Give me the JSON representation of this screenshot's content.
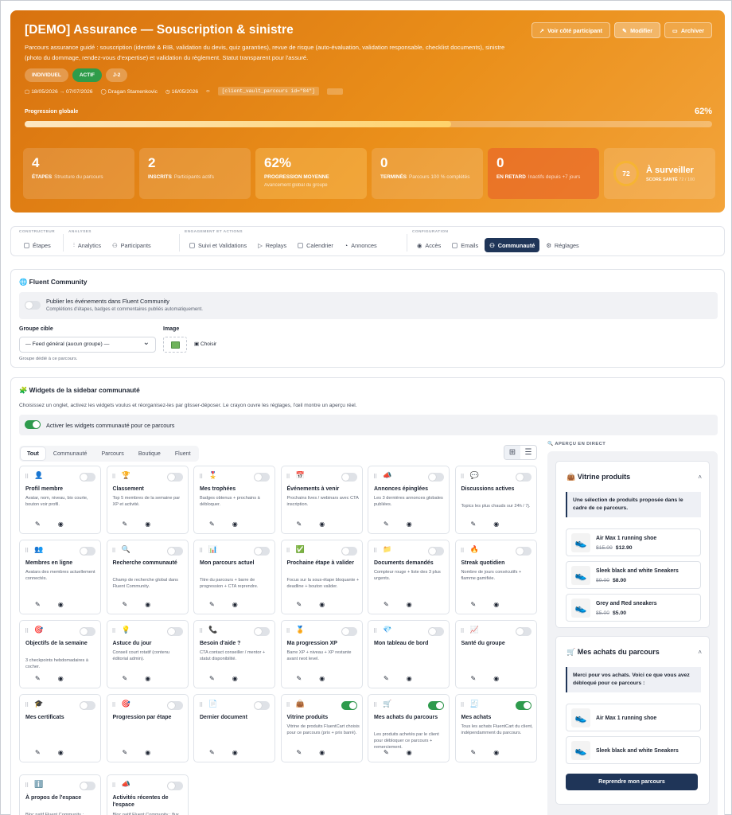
{
  "header": {
    "title": "[DEMO] Assurance — Souscription & sinistre",
    "description": "Parcours assurance guidé : souscription (identité & RIB, validation du devis, quiz garanties), revue de risque (auto-évaluation, validation responsable, checklist documents), sinistre (photo du dommage, rendez-vous d'expertise) et validation du règlement. Statut transparent pour l'assuré.",
    "buttons": {
      "view": "Voir côté participant",
      "edit": "Modifier",
      "archive": "Archiver"
    },
    "tags": [
      "INDIVIDUEL",
      "ACTIF",
      "J-2"
    ],
    "meta": {
      "dates": "18/05/2026 → 07/07/2026",
      "author": "Dragan Stamenkovic",
      "created": "16/05/2026",
      "shortcode": "[client_vault_parcours id=\"84\"]"
    },
    "progress": {
      "label": "Progression globale",
      "value_text": "62%",
      "value": 62
    },
    "stats": [
      {
        "value": "4",
        "label": "ÉTAPES",
        "hint": "Structure du parcours"
      },
      {
        "value": "2",
        "label": "INSCRITS",
        "hint": "Participants actifs"
      },
      {
        "value": "62%",
        "label": "PROGRESSION MOYENNE",
        "sub": "Avancement global du groupe"
      },
      {
        "value": "0",
        "label": "TERMINÉS",
        "hint": "Parcours 100 % complétés"
      },
      {
        "value": "0",
        "label": "EN RETARD",
        "hint": "Inactifs depuis +7 jours"
      }
    ],
    "score": {
      "value": "72",
      "title": "À surveiller",
      "label": "SCORE SANTÉ",
      "detail": "72 / 100"
    }
  },
  "nav": {
    "groups": [
      {
        "label": "CONSTRUCTEUR",
        "items": [
          "Étapes"
        ]
      },
      {
        "label": "ANALYSES",
        "items": [
          "Analytics",
          "Participants"
        ]
      },
      {
        "label": "ENGAGEMENT ET ACTIONS",
        "items": [
          "Suivi et Validations",
          "Replays",
          "Calendrier",
          "Annonces"
        ]
      },
      {
        "label": "CONFIGURATION",
        "items": [
          "Accès",
          "Emails",
          "Communauté",
          "Réglages"
        ]
      }
    ],
    "active": "Communauté"
  },
  "fluent": {
    "title": "Fluent Community",
    "publish_title": "Publier les événements dans Fluent Community",
    "publish_sub": "Complétions d'étapes, badges et commentaires publiés automatiquement.",
    "publish_on": false,
    "group_label": "Groupe cible",
    "group_value": "— Feed général (aucun groupe) —",
    "group_hint": "Groupe dédié à ce parcours.",
    "image_label": "Image",
    "choose": "Choisir"
  },
  "widgets": {
    "title": "Widgets de la sidebar communauté",
    "subtitle": "Choisissez un onglet, activez les widgets voulus et réorganisez-les par glisser-déposer. Le crayon ouvre les réglages, l'œil montre un aperçu réel.",
    "enable_label": "Activer les widgets communauté pour ce parcours",
    "enabled": true,
    "tabs": [
      "Tout",
      "Communauté",
      "Parcours",
      "Boutique",
      "Fluent"
    ],
    "active_tab": "Tout",
    "items": [
      {
        "icon": "👤",
        "name": "Profil membre",
        "desc": "Avatar, nom, niveau, bio courte, bouton voir profil.",
        "on": false
      },
      {
        "icon": "🏆",
        "name": "Classement",
        "desc": "Top 5 membres de la semaine par XP et activité.",
        "on": false
      },
      {
        "icon": "🎖️",
        "name": "Mes trophées",
        "desc": "Badges obtenus + prochains à débloquer.",
        "on": false
      },
      {
        "icon": "📅",
        "name": "Événements à venir",
        "desc": "Prochains lives / webinars avec CTA inscription.",
        "on": false
      },
      {
        "icon": "📣",
        "name": "Annonces épinglées",
        "desc": "Les 3 dernières annonces globales publiées.",
        "on": false
      },
      {
        "icon": "💬",
        "name": "Discussions actives",
        "desc": "Topics les plus chauds sur 24h / 7j.",
        "on": false
      },
      {
        "icon": "👥",
        "name": "Membres en ligne",
        "desc": "Avatars des membres actuellement connectés.",
        "on": false
      },
      {
        "icon": "🔍",
        "name": "Recherche communauté",
        "desc": "Champ de recherche global dans Fluent Community.",
        "on": false
      },
      {
        "icon": "📊",
        "name": "Mon parcours actuel",
        "desc": "Titre du parcours + barre de progression + CTA reprendre.",
        "on": false
      },
      {
        "icon": "✅",
        "name": "Prochaine étape à valider",
        "desc": "Focus sur la sous-étape bloquante + deadline + bouton valider.",
        "on": false
      },
      {
        "icon": "📁",
        "name": "Documents demandés",
        "desc": "Compteur rouge + liste des 3 plus urgents.",
        "on": false
      },
      {
        "icon": "🔥",
        "name": "Streak quotidien",
        "desc": "Nombre de jours consécutifs + flamme gamifiée.",
        "on": false
      },
      {
        "icon": "🎯",
        "name": "Objectifs de la semaine",
        "desc": "3 checkpoints hebdomadaires à cocher.",
        "on": false
      },
      {
        "icon": "💡",
        "name": "Astuce du jour",
        "desc": "Conseil court rotatif (contenu éditorial admin).",
        "on": false
      },
      {
        "icon": "📞",
        "name": "Besoin d'aide ?",
        "desc": "CTA contact conseiller / mentor + statut disponibilité.",
        "on": false
      },
      {
        "icon": "🏅",
        "name": "Ma progression XP",
        "desc": "Barre XP + niveau + XP restante avant next level.",
        "on": false
      },
      {
        "icon": "💎",
        "name": "Mon tableau de bord",
        "desc": "",
        "on": false
      },
      {
        "icon": "📈",
        "name": "Santé du groupe",
        "desc": "",
        "on": false
      },
      {
        "icon": "🎓",
        "name": "Mes certificats",
        "desc": "",
        "on": false
      },
      {
        "icon": "🎯",
        "name": "Progression par étape",
        "desc": "",
        "on": false
      },
      {
        "icon": "📄",
        "name": "Dernier document",
        "desc": "",
        "on": false
      },
      {
        "icon": "👜",
        "name": "Vitrine produits",
        "desc": "Vitrine de produits FluentCart choisis pour ce parcours (prix + prix barré).",
        "on": true
      },
      {
        "icon": "🛒",
        "name": "Mes achats du parcours",
        "desc": "Les produits achetés par le client pour débloquer ce parcours + remerciement.",
        "on": true
      },
      {
        "icon": "🧾",
        "name": "Mes achats",
        "desc": "Tous les achats FluentCart du client, indépendamment du parcours.",
        "on": true
      },
      {
        "icon": "ℹ️",
        "name": "À propos de l'espace",
        "desc": "Bloc natif Fluent Community : description et informations de",
        "on": false
      },
      {
        "icon": "📣",
        "name": "Activités récentes de l'espace",
        "desc": "Bloc natif Fluent Community : flux des dernières activités de",
        "on": false
      }
    ]
  },
  "preview": {
    "label": "APERÇU EN DIRECT",
    "showcase": {
      "icon": "👜",
      "title": "Vitrine produits",
      "intro": "Une sélection de produits proposée dans le cadre de ce parcours.",
      "products": [
        {
          "name": "Air Max 1 running shoe",
          "old": "$15.00",
          "price": "$12.90"
        },
        {
          "name": "Sleek black and white Sneakers",
          "old": "$9.00",
          "price": "$8.00"
        },
        {
          "name": "Grey and Red sneakers",
          "old": "$5.00",
          "price": "$5.00"
        }
      ]
    },
    "purchases": {
      "icon": "🛒",
      "title": "Mes achats du parcours",
      "intro": "Merci pour vos achats. Voici ce que vous avez débloqué pour ce parcours :",
      "products": [
        {
          "name": "Air Max 1 running shoe"
        },
        {
          "name": "Sleek black and white Sneakers"
        }
      ],
      "cta": "Reprendre mon parcours"
    }
  }
}
